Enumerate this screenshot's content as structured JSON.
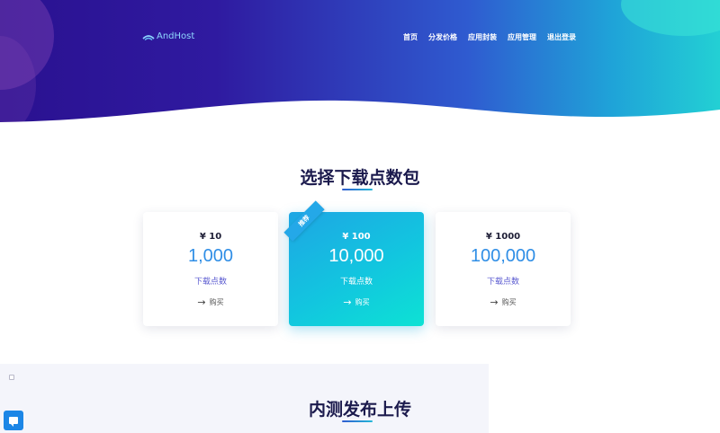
{
  "header": {
    "logo_text": "AndHost",
    "nav": [
      "首页",
      "分发价格",
      "应用封装",
      "应用管理",
      "退出登录"
    ]
  },
  "pricing": {
    "title": "选择下载点数包",
    "badge": "推荐",
    "packages": [
      {
        "price": "¥ 10",
        "amount": "1,000",
        "unit": "下载点数",
        "buy_label": "购买"
      },
      {
        "price": "¥ 100",
        "amount": "10,000",
        "unit": "下载点数",
        "buy_label": "购买"
      },
      {
        "price": "¥ 1000",
        "amount": "100,000",
        "unit": "下载点数",
        "buy_label": "购买"
      }
    ]
  },
  "beta": {
    "title": "内测发布上传"
  },
  "colors": {
    "accent_blue": "#2f8ee6",
    "hero_start": "#2a1190",
    "hero_end": "#23d0d4",
    "chat_button": "#1c86e6"
  }
}
